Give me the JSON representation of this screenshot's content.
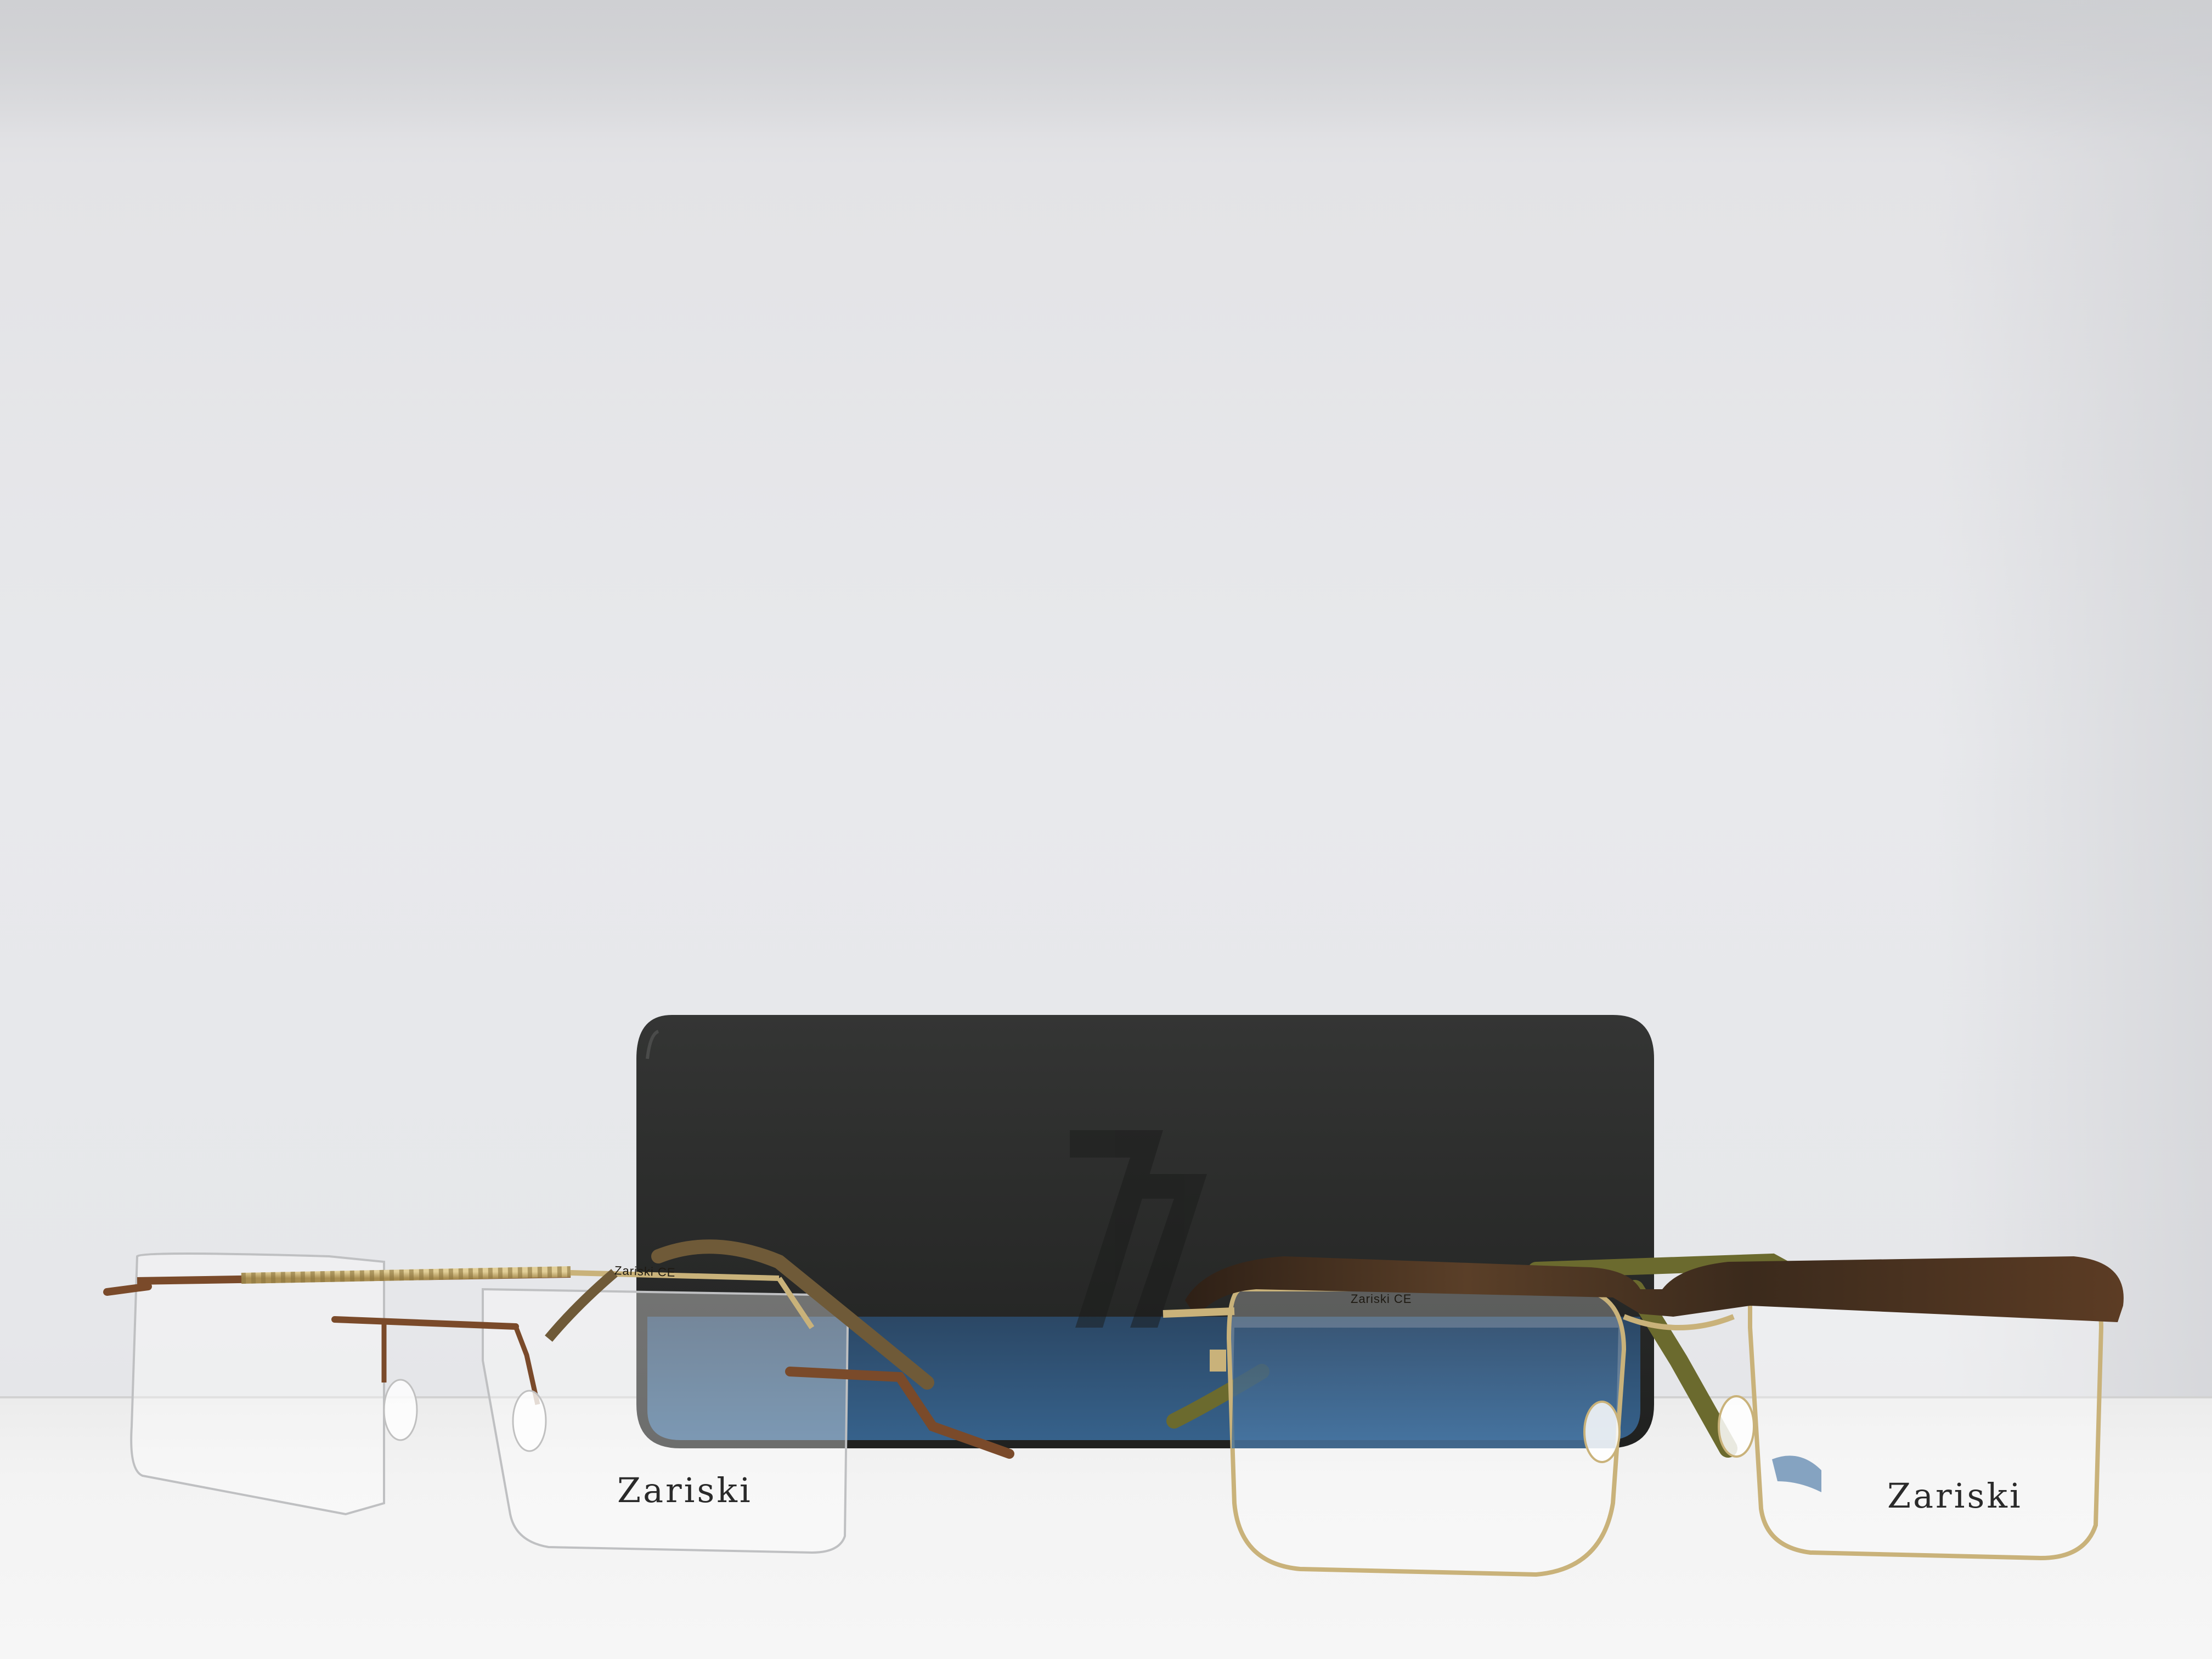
{
  "photo": {
    "left_frame": {
      "lens_brand": "Zariski",
      "temple_imprint": "Zariski CE"
    },
    "right_frame": {
      "lens_brand": "Zariski",
      "temple_imprint": "Zariski CE"
    },
    "case_monogram": "77"
  },
  "colors": {
    "wall": "#e6e7ea",
    "shelf": "#f3f3f3",
    "case": "#2b2c2b",
    "gold_metal": "#c9b27a",
    "bronze_metal": "#7a4a2a",
    "tortoise": "#4a3424",
    "olive_temple": "#6b6a2e",
    "blue_reflection": "#2f5a86"
  }
}
